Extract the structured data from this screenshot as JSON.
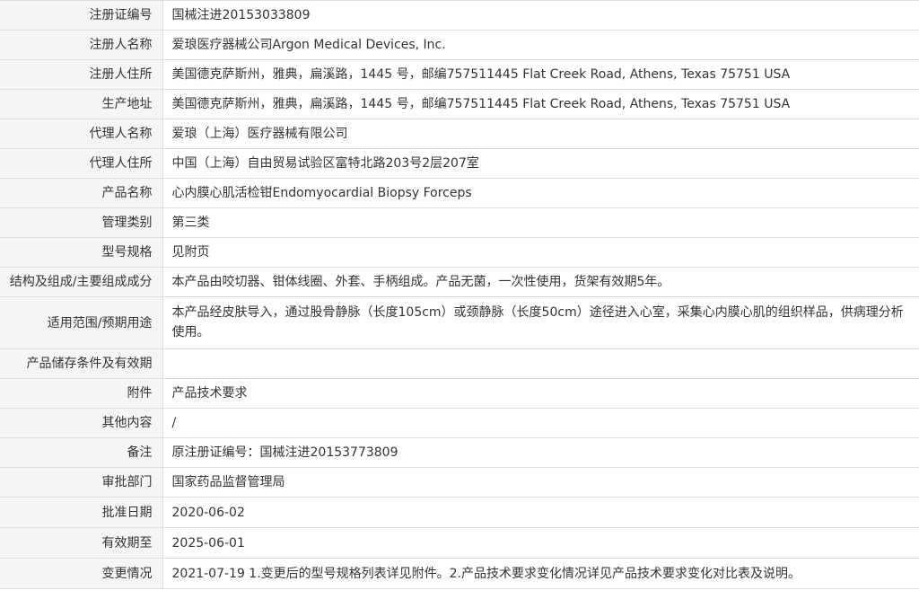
{
  "rows": [
    {
      "label": "注册证编号",
      "value": "国械注进20153033809"
    },
    {
      "label": "注册人名称",
      "value": "爱琅医疗器械公司Argon Medical Devices, Inc."
    },
    {
      "label": "注册人住所",
      "value": "美国德克萨斯州，雅典，扁溪路，1445 号，邮编757511445 Flat Creek Road, Athens, Texas 75751 USA"
    },
    {
      "label": "生产地址",
      "value": "美国德克萨斯州，雅典，扁溪路，1445 号，邮编757511445 Flat Creek Road, Athens, Texas 75751 USA"
    },
    {
      "label": "代理人名称",
      "value": "爱琅（上海）医疗器械有限公司"
    },
    {
      "label": "代理人住所",
      "value": "中国（上海）自由贸易试验区富特北路203号2层207室"
    },
    {
      "label": "产品名称",
      "value": "心内膜心肌活检钳Endomyocardial Biopsy Forceps"
    },
    {
      "label": "管理类别",
      "value": "第三类"
    },
    {
      "label": "型号规格",
      "value": "见附页"
    },
    {
      "label": "结构及组成/主要组成成分",
      "value": "本产品由咬切器、钳体线圈、外套、手柄组成。产品无菌，一次性使用，货架有效期5年。"
    },
    {
      "label": "适用范围/预期用途",
      "value": "本产品经皮肤导入，通过股骨静脉（长度105cm）或颈静脉（长度50cm）途径进入心室，采集心内膜心肌的组织样品，供病理分析使用。"
    },
    {
      "label": "产品储存条件及有效期",
      "value": ""
    },
    {
      "label": "附件",
      "value": "产品技术要求"
    },
    {
      "label": "其他内容",
      "value": "/"
    },
    {
      "label": "备注",
      "value": "原注册证编号：国械注进20153773809"
    },
    {
      "label": "审批部门",
      "value": "国家药品监督管理局"
    },
    {
      "label": "批准日期",
      "value": "2020-06-02"
    },
    {
      "label": "有效期至",
      "value": "2025-06-01"
    },
    {
      "label": "变更情况",
      "value": "2021-07-19 1.变更后的型号规格列表详见附件。2.产品技术要求变化情况详见产品技术要求变化对比表及说明。"
    }
  ]
}
